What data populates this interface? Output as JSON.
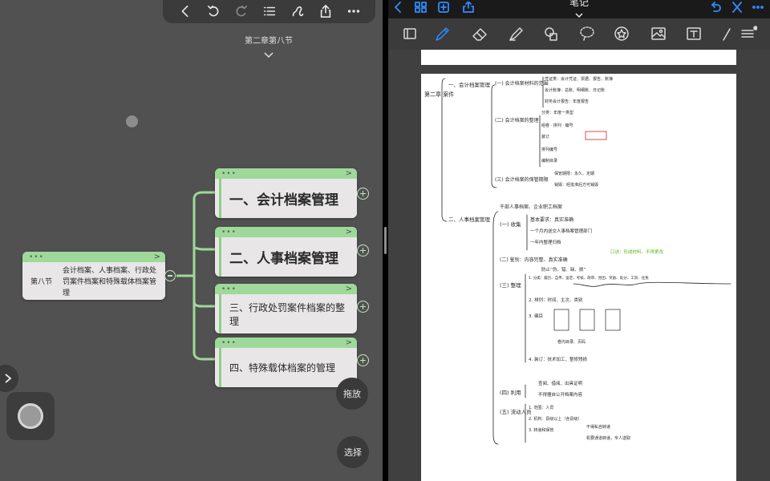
{
  "mindmap": {
    "breadcrumb": "第二章第八节",
    "root": {
      "label_a": "第八节",
      "label_b": "会计档案、人事档案、行政处罚案件档案和特殊载体档案管理"
    },
    "topics": [
      {
        "label": "一、会计档案管理"
      },
      {
        "label": "二、人事档案管理"
      },
      {
        "label": "三、行政处罚案件档案的整理"
      },
      {
        "label": "四、特殊载体档案的管理"
      }
    ],
    "header_dots": "•••",
    "header_arrow": ">",
    "buttons": {
      "drag": "拖放",
      "select": "选择"
    },
    "toolbar_icons": [
      "chevron-left-icon",
      "undo-icon",
      "redo-icon",
      "list-icon",
      "style-icon",
      "share-icon",
      "more-icon"
    ]
  },
  "notes": {
    "title": "笔记",
    "accent_color": "#2f8cff",
    "tools": [
      "page-layout-icon",
      "pen-icon",
      "eraser-icon",
      "highlighter-icon",
      "shapes-icon",
      "lasso-icon",
      "sticker-icon",
      "image-icon",
      "text-icon",
      "ruler-icon",
      "menu-icon"
    ],
    "handwriting": {
      "chapter": "第二章 案件",
      "s1": "一、会计档案管理",
      "s1_1": "(一) 会计档案材料的范围",
      "s1_1_a": "凭证类：会计凭证、票据、报告、账簿",
      "s1_1_b": "会计账簿：总账、明细账、日记账",
      "s1_1_c": "财务会计报告：年度报告",
      "s1_2": "(二) 会计档案的整理",
      "s1_2_a": "分类：年度一类型",
      "s1_2_b": "组卷 · 排列 · 编号",
      "s1_2_c": "装订",
      "s1_2_d": "排列编号",
      "s1_2_e": "编制目录",
      "s1_3": "(三) 会计档案的保管期限",
      "s1_3_a": "保管期限：永久、定期",
      "s1_3_b": "销毁：经批准后方可销毁",
      "s2": "二、人事档案管理",
      "s2_0": "干部人事档案、企业职工档案",
      "s2_1": "(一) 收集",
      "s2_1_a": "基本要求：真实准确",
      "s2_1_b": "一个月内送交人事档案管理部门",
      "s2_1_c": "一年内整理归档",
      "s2_2": "(二) 鉴别：内容完整、真实准确",
      "s2_2_a": "防止“伪、错、缺、损”",
      "s2_2_note": "口诀：形成材料、不得更改",
      "s2_3": "(三) 整理",
      "s2_3_a": "1. 分类：履历、自传、鉴定、考核、政审、党团、奖励、处分、工资、任免",
      "s2_3_b": "2. 排列：时间、主次、类别",
      "s2_3_c": "3. 编目",
      "s2_3_d": "4. 装订：技术加工、整修残损",
      "s2_3_e": "卷内目录、页码",
      "s2_4": "(四) 利用",
      "s2_4_a": "查阅、借阅、出具证明",
      "s2_4_b": "不得擅自公开档案内容",
      "s2_5": "(五) 流动人员",
      "s2_5_a": "1. 范围：人员",
      "s2_5_b": "2. 机构：县级以上（含县级）",
      "s2_5_c": "3. 转递和保管",
      "s2_5_d": "不得私自转递",
      "s2_5_e": "机要通道转递，专人送取"
    }
  }
}
